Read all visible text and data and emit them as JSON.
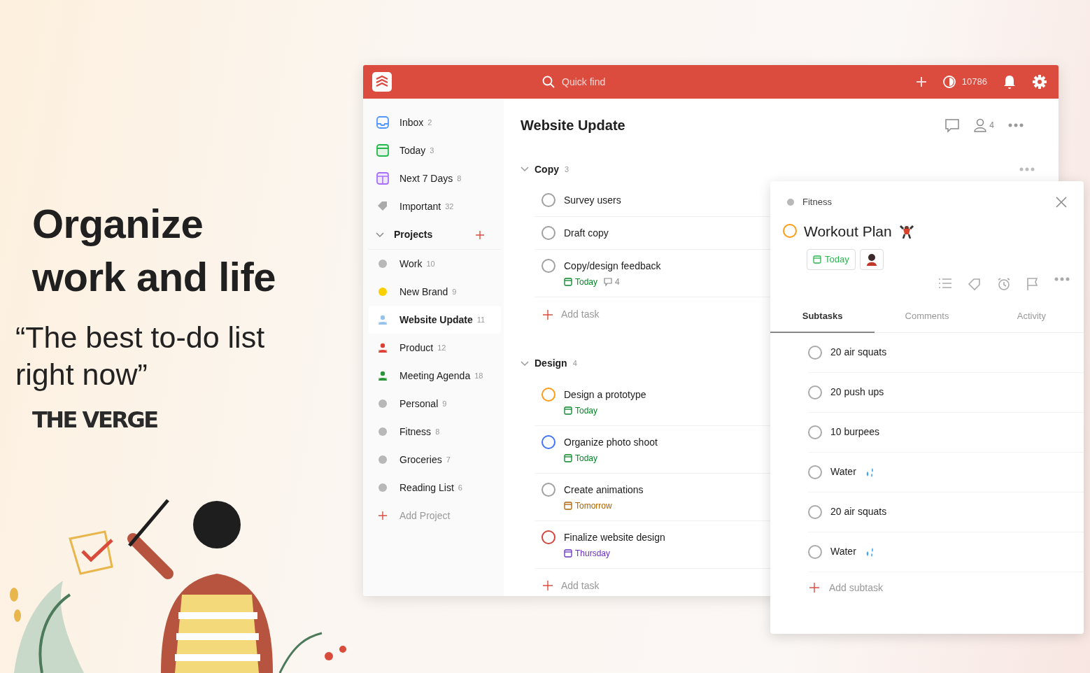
{
  "promo": {
    "headline_lines": [
      "Organize",
      "work and life"
    ],
    "quote_lines": [
      "“The best to-do list",
      "right now”"
    ],
    "source": "THE VERGE"
  },
  "topbar": {
    "search": {
      "placeholder": "Quick find"
    },
    "karma": "10786"
  },
  "sidebar": {
    "filters": [
      {
        "label": "Inbox",
        "count": "2",
        "kind": "inbox"
      },
      {
        "label": "Today",
        "count": "3",
        "kind": "today"
      },
      {
        "label": "Next 7 Days",
        "count": "8",
        "kind": "week"
      },
      {
        "label": "Important",
        "count": "32",
        "kind": "label"
      }
    ],
    "projects_header": "Projects",
    "projects": [
      {
        "name": "Work",
        "count": "10",
        "color": "#b8b8b8",
        "kind": "dot",
        "selected": false
      },
      {
        "name": "New Brand",
        "count": "9",
        "color": "#fad000",
        "kind": "dot",
        "selected": false
      },
      {
        "name": "Website Update",
        "count": "11",
        "color": "#96c3eb",
        "kind": "person",
        "selected": true
      },
      {
        "name": "Product",
        "count": "12",
        "color": "#db4035",
        "kind": "person",
        "selected": false
      },
      {
        "name": "Meeting Agenda",
        "count": "18",
        "color": "#299438",
        "kind": "person",
        "selected": false
      },
      {
        "name": "Personal",
        "count": "9",
        "color": "#b8b8b8",
        "kind": "dot",
        "selected": false
      },
      {
        "name": "Fitness",
        "count": "8",
        "color": "#b8b8b8",
        "kind": "dot",
        "selected": false
      },
      {
        "name": "Groceries",
        "count": "7",
        "color": "#b8b8b8",
        "kind": "dot",
        "selected": false
      },
      {
        "name": "Reading List",
        "count": "6",
        "color": "#b8b8b8",
        "kind": "dot",
        "selected": false
      }
    ],
    "add_project": "Add Project"
  },
  "main": {
    "title": "Website Update",
    "collaborators": "4",
    "sections": [
      {
        "title": "Copy",
        "count": "3",
        "expanded": true,
        "add_task": "Add task",
        "tasks": [
          {
            "title": "Survey users",
            "color": "#a0a0a0"
          },
          {
            "title": "Draft copy",
            "color": "#a0a0a0"
          },
          {
            "title": "Copy/design feedback",
            "color": "#a0a0a0",
            "due": {
              "label": "Today",
              "color": "#058527"
            },
            "comments": "4"
          }
        ]
      },
      {
        "title": "Design",
        "count": "4",
        "expanded": true,
        "add_task": "Add task",
        "tasks": [
          {
            "title": "Design a prototype",
            "color": "#ff9a14",
            "due": {
              "label": "Today",
              "color": "#058527"
            }
          },
          {
            "title": "Organize photo shoot",
            "color": "#4073ff",
            "due": {
              "label": "Today",
              "color": "#058527"
            }
          },
          {
            "title": "Create animations",
            "color": "#a0a0a0",
            "due": {
              "label": "Tomorrow",
              "color": "#ad6200"
            }
          },
          {
            "title": "Finalize website design",
            "color": "#d1453b",
            "due": {
              "label": "Thursday",
              "color": "#692fc2"
            }
          }
        ]
      }
    ]
  },
  "detail": {
    "project": "Fitness",
    "title": "Workout Plan",
    "color": "#ff9a14",
    "due": "Today",
    "tabs": [
      {
        "label": "Subtasks",
        "selected": true
      },
      {
        "label": "Comments",
        "selected": false
      },
      {
        "label": "Activity",
        "selected": false
      }
    ],
    "subtasks": [
      {
        "title": "20 air squats",
        "kind": "plain",
        "checked": false
      },
      {
        "title": "20 push ups",
        "kind": "plain",
        "checked": false
      },
      {
        "title": "10 burpees",
        "kind": "plain",
        "checked": false
      },
      {
        "title": "Water",
        "kind": "droplets",
        "checked": false
      },
      {
        "title": "20 air squats",
        "kind": "plain",
        "checked": false
      },
      {
        "title": "Water",
        "kind": "droplets",
        "checked": false
      }
    ],
    "add_subtask": "Add subtask"
  }
}
